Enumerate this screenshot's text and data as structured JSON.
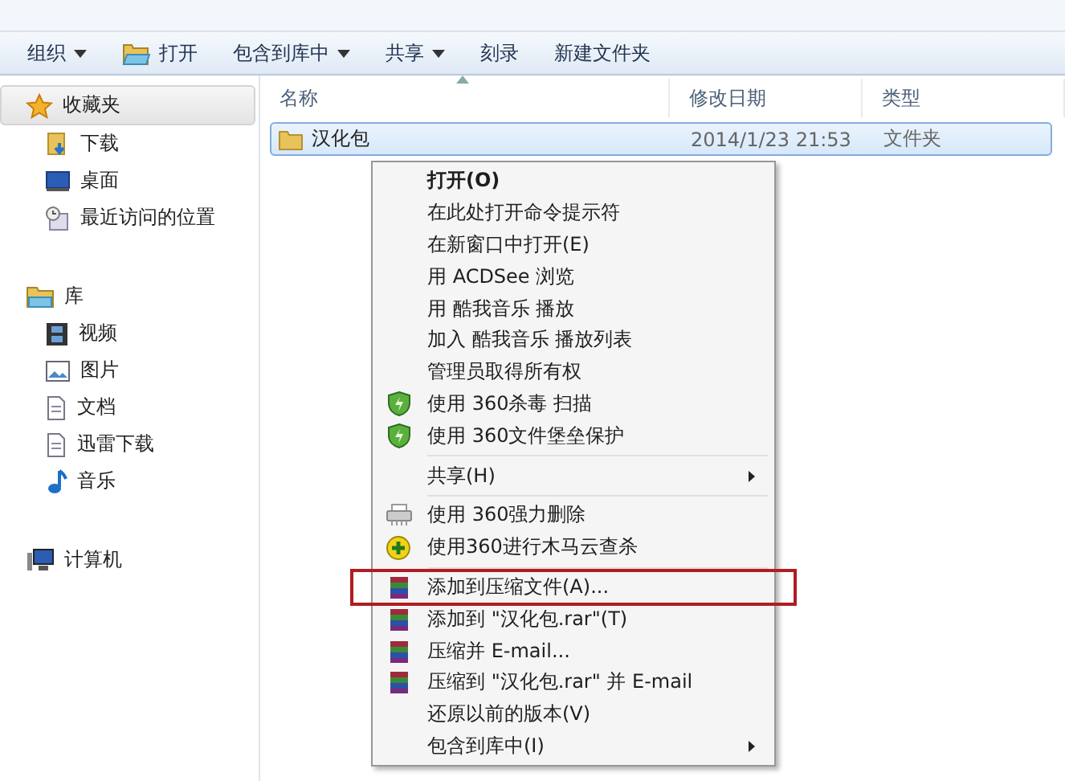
{
  "toolbar": {
    "items": [
      {
        "label": "组织",
        "kind": "dropdown"
      },
      {
        "label": "打开",
        "kind": "open"
      },
      {
        "label": "包含到库中",
        "kind": "dropdown"
      },
      {
        "label": "共享",
        "kind": "dropdown"
      },
      {
        "label": "刻录",
        "kind": "plain"
      },
      {
        "label": "新建文件夹",
        "kind": "plain"
      }
    ]
  },
  "sidebar": {
    "groups": [
      {
        "label": "收藏夹",
        "kind": "star",
        "selected": true,
        "children": [
          {
            "label": "下载",
            "kind": "download"
          },
          {
            "label": "桌面",
            "kind": "desktop"
          },
          {
            "label": "最近访问的位置",
            "kind": "recent"
          }
        ]
      },
      {
        "label": "库",
        "kind": "library",
        "selected": false,
        "children": [
          {
            "label": "视频",
            "kind": "video"
          },
          {
            "label": "图片",
            "kind": "picture"
          },
          {
            "label": "文档",
            "kind": "document"
          },
          {
            "label": "迅雷下载",
            "kind": "document"
          },
          {
            "label": "音乐",
            "kind": "music"
          }
        ]
      },
      {
        "label": "计算机",
        "kind": "computer",
        "selected": false
      }
    ]
  },
  "table": {
    "columns": [
      "名称",
      "修改日期",
      "类型"
    ],
    "rows": [
      {
        "name": "汉化包",
        "date": "2014/1/23 21:53",
        "type": "文件夹",
        "selected": true
      }
    ]
  },
  "context_menu": {
    "items": [
      {
        "label": "打开(O)",
        "kind": "default",
        "highlighted": false
      },
      {
        "label": "在此处打开命令提示符",
        "kind": "item",
        "highlighted": false
      },
      {
        "label": "在新窗口中打开(E)",
        "kind": "item",
        "highlighted": false
      },
      {
        "label": "用 ACDSee 浏览",
        "kind": "item",
        "highlighted": false
      },
      {
        "label": "用 酷我音乐 播放",
        "kind": "item",
        "highlighted": false
      },
      {
        "label": "加入 酷我音乐 播放列表",
        "kind": "item",
        "highlighted": false
      },
      {
        "label": "管理员取得所有权",
        "kind": "item",
        "highlighted": false
      },
      {
        "label": "使用 360杀毒 扫描",
        "kind": "shield",
        "highlighted": false
      },
      {
        "label": "使用 360文件堡垒保护",
        "kind": "shield",
        "highlighted": false
      },
      {
        "kind": "separator"
      },
      {
        "label": "共享(H)",
        "kind": "submenu",
        "highlighted": false
      },
      {
        "kind": "separator"
      },
      {
        "label": "使用 360强力删除",
        "kind": "shredder",
        "highlighted": false
      },
      {
        "label": "使用360进行木马云查杀",
        "kind": "plus",
        "highlighted": false
      },
      {
        "kind": "separator"
      },
      {
        "label": "添加到压缩文件(A)...",
        "kind": "books",
        "highlighted": true
      },
      {
        "label": "添加到 \"汉化包.rar\"(T)",
        "kind": "books",
        "highlighted": false
      },
      {
        "label": "压缩并 E-mail...",
        "kind": "books",
        "highlighted": false
      },
      {
        "label": "压缩到 \"汉化包.rar\" 并 E-mail",
        "kind": "books",
        "highlighted": false
      },
      {
        "label": "还原以前的版本(V)",
        "kind": "item",
        "highlighted": false
      },
      {
        "label": "包含到库中(I)",
        "kind": "submenu",
        "highlighted": false
      }
    ]
  }
}
